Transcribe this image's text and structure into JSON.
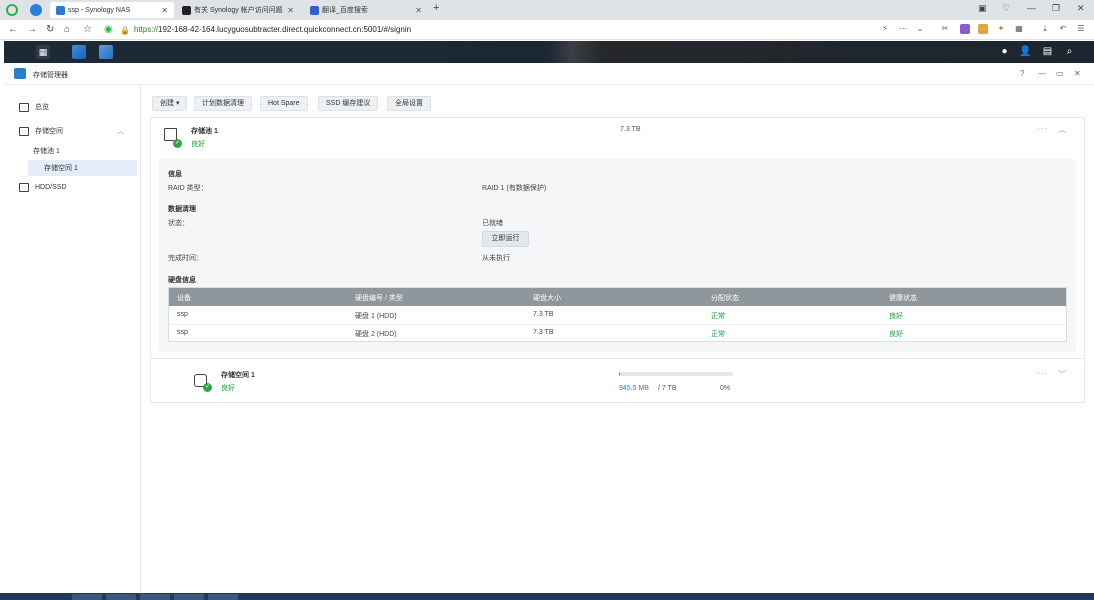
{
  "browser": {
    "tabs": [
      {
        "label": "ssp - Synology NAS",
        "active": true
      },
      {
        "label": "有关 Synology 帐户访问问题",
        "active": false
      },
      {
        "label": "翻译_百度搜索",
        "active": false
      }
    ],
    "new_tab": "+",
    "url_prefix": "https://",
    "url_host": "192-168-42-164.lucyguosubtracter.direct.quickconnect.cn",
    "url_path": ":5001/#/signin"
  },
  "app": {
    "title": "存储管理器",
    "window_controls": [
      "?",
      "—",
      "▭",
      "✕"
    ]
  },
  "sidebar": {
    "items": [
      {
        "label": "总览",
        "icon": "overview-icon"
      },
      {
        "label": "存储空间",
        "icon": "storage-icon"
      },
      {
        "label": "存储池 1"
      },
      {
        "label": "存储空间 1"
      },
      {
        "label": "HDD/SSD",
        "icon": "disk-icon"
      }
    ]
  },
  "toolbar": {
    "create": "创建 ▾",
    "scrub": "计划数据清理",
    "hotspare": "Hot Spare",
    "ssd": "SSD 缓存建议",
    "global": "全局设置"
  },
  "pool": {
    "name": "存储池 1",
    "status": "良好",
    "size": "7.3 TB",
    "info_title": "信息",
    "raid_label": "RAID 类型：",
    "raid_value": "RAID 1 (有数据保护)",
    "scrub_title": "数据清理",
    "state_label": "状态：",
    "state_value": "已就绪",
    "run_now": "立即运行",
    "done_label": "完成时间：",
    "done_value": "从未执行",
    "disk_title": "硬盘信息",
    "table": {
      "headers": [
        "设备",
        "硬盘编号 / 类型",
        "硬盘大小",
        "分配状态",
        "健康状态"
      ],
      "rows": [
        [
          "ssp",
          "硬盘 1 (HDD)",
          "7.3 TB",
          "正常",
          "良好"
        ],
        [
          "ssp",
          "硬盘 2 (HDD)",
          "7.3 TB",
          "正常",
          "良好"
        ]
      ]
    }
  },
  "volume": {
    "name": "存储空间 1",
    "status": "良好",
    "used": "945.5 MB",
    "total": "/ 7 TB",
    "percent_text": "0%",
    "percent_value": 0.01
  },
  "colors": {
    "accent": "#2f7bc9",
    "good": "#1f9b3f"
  }
}
